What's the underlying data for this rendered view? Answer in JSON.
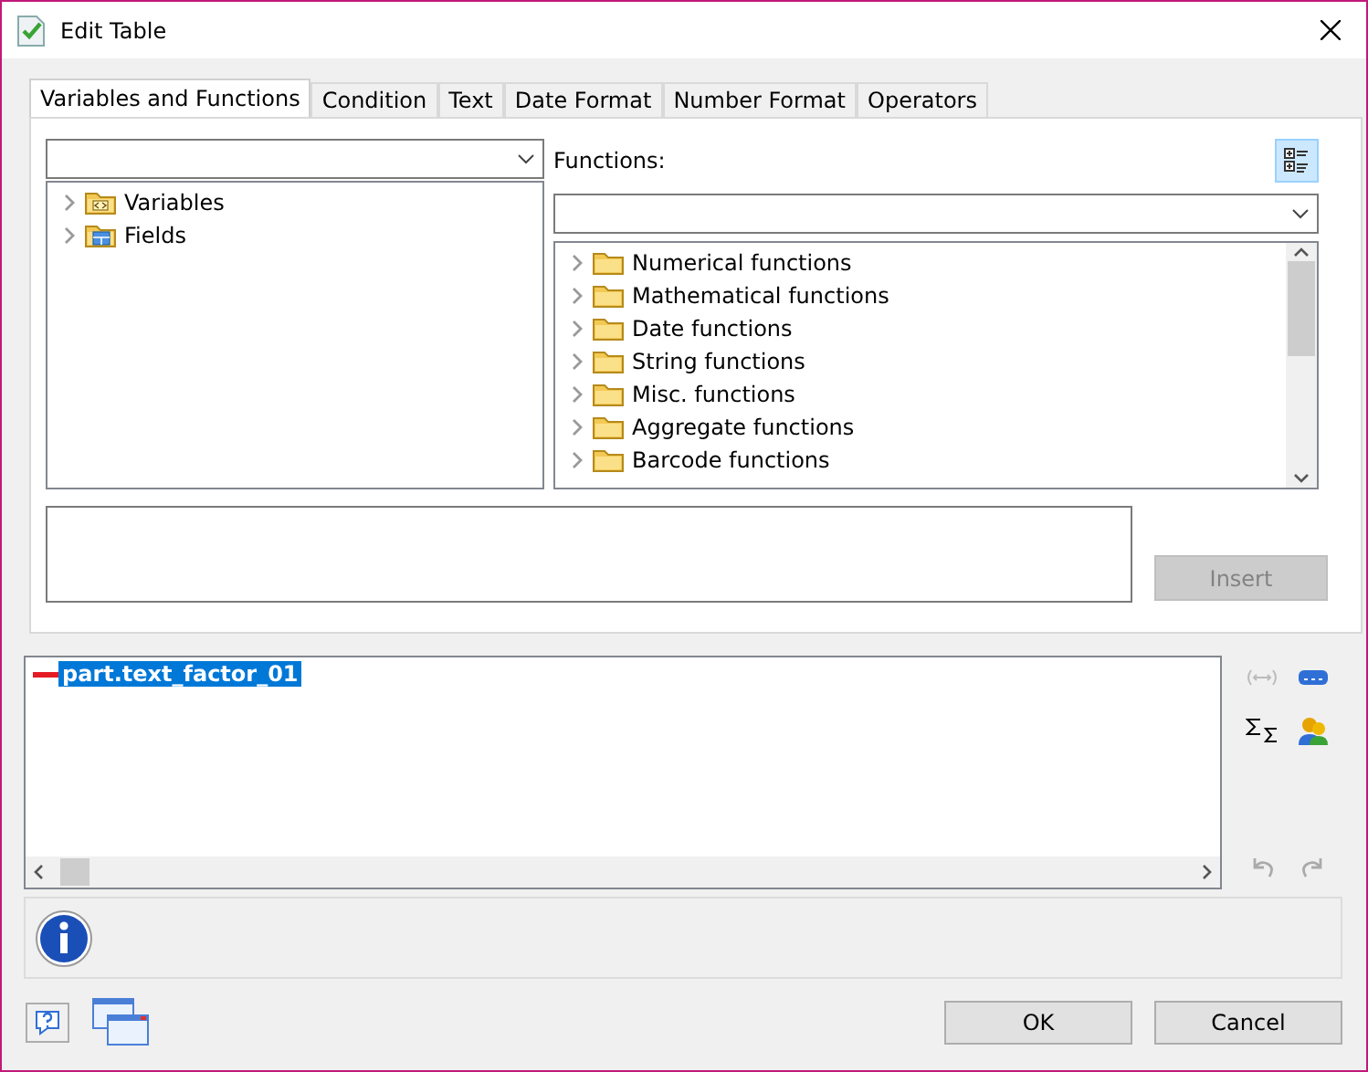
{
  "window": {
    "title": "Edit Table"
  },
  "tabs": [
    {
      "label": "Variables and Functions",
      "selected": true
    },
    {
      "label": "Condition",
      "selected": false
    },
    {
      "label": "Text",
      "selected": false
    },
    {
      "label": "Date Format",
      "selected": false
    },
    {
      "label": "Number Format",
      "selected": false
    },
    {
      "label": "Operators",
      "selected": false
    }
  ],
  "variables_tree": [
    {
      "label": "Variables",
      "kind": "variables",
      "expanded": false
    },
    {
      "label": "Fields",
      "kind": "fields",
      "expanded": false
    }
  ],
  "functions": {
    "label": "Functions:",
    "items": [
      {
        "label": "Numerical functions",
        "expanded": false
      },
      {
        "label": "Mathematical functions",
        "expanded": false
      },
      {
        "label": "Date functions",
        "expanded": false
      },
      {
        "label": "String functions",
        "expanded": false
      },
      {
        "label": "Misc. functions",
        "expanded": false
      },
      {
        "label": "Aggregate functions",
        "expanded": false
      },
      {
        "label": "Barcode functions",
        "expanded": false
      }
    ]
  },
  "insert_button": {
    "label": "Insert",
    "disabled": true
  },
  "editor": {
    "value": "part.text_factor_01",
    "selected": true
  },
  "buttons": [
    {
      "label": "OK"
    },
    {
      "label": "Cancel"
    }
  ]
}
